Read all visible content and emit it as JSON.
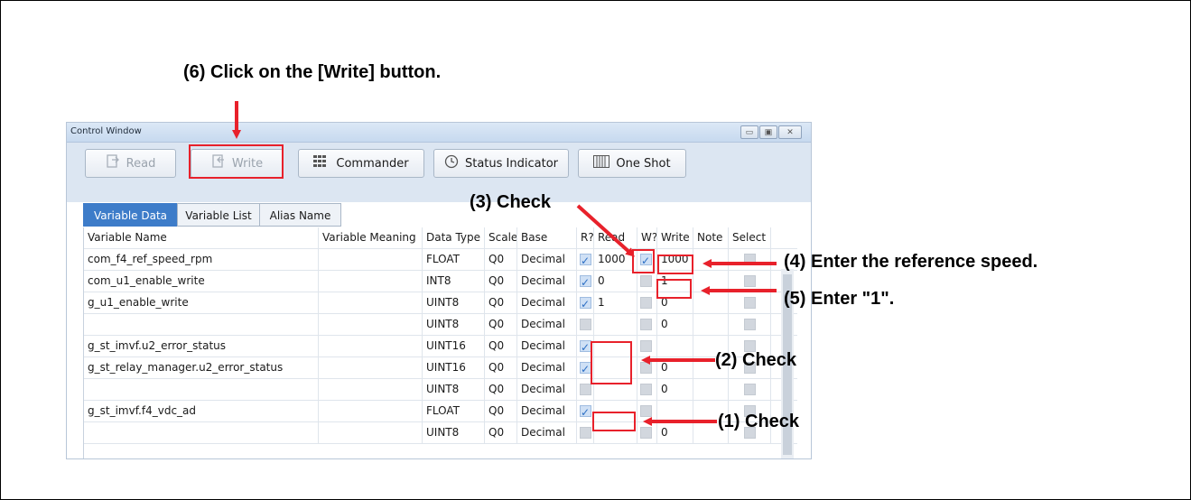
{
  "annotations": {
    "step6": "(6) Click on the [Write] button.",
    "step3": "(3) Check",
    "step4": "(4) Enter the reference speed.",
    "step5": "(5) Enter \"1\".",
    "step2": "(2) Check",
    "step1": "(1) Check",
    "accent_color": "#e8212b"
  },
  "window": {
    "title": "Control Window",
    "controls": [
      "minimize-icon",
      "maximize-icon",
      "close-icon"
    ]
  },
  "toolbar": {
    "read_label": "Read",
    "write_label": "Write",
    "commander_label": "Commander",
    "status_label": "Status Indicator",
    "oneshot_label": "One Shot",
    "read_icon": "read-icon",
    "write_icon": "write-icon",
    "commander_icon": "commander-icon",
    "status_icon": "clock-icon",
    "oneshot_icon": "one-shot-icon"
  },
  "tabs": [
    "Variable Data",
    "Variable List",
    "Alias Name"
  ],
  "table": {
    "headers": [
      "Variable Name",
      "Variable Meaning",
      "Data Type",
      "Scale",
      "Base",
      "R?",
      "Read",
      "W?",
      "Write",
      "Note",
      "Select"
    ],
    "rows": [
      {
        "name": "com_f4_ref_speed_rpm",
        "meaning": "",
        "type": "FLOAT",
        "scale": "Q0",
        "base": "Decimal",
        "r": true,
        "read": "1000",
        "w": true,
        "write": "1000"
      },
      {
        "name": "com_u1_enable_write",
        "meaning": "",
        "type": "INT8",
        "scale": "Q0",
        "base": "Decimal",
        "r": true,
        "read": "0",
        "w": false,
        "write": "1"
      },
      {
        "name": "g_u1_enable_write",
        "meaning": "",
        "type": "UINT8",
        "scale": "Q0",
        "base": "Decimal",
        "r": true,
        "read": "1",
        "w": false,
        "write": "0"
      },
      {
        "name": "",
        "meaning": "",
        "type": "UINT8",
        "scale": "Q0",
        "base": "Decimal",
        "r": false,
        "read": "",
        "w": false,
        "write": "0"
      },
      {
        "name": "g_st_imvf.u2_error_status",
        "meaning": "",
        "type": "UINT16",
        "scale": "Q0",
        "base": "Decimal",
        "r": true,
        "read": "",
        "w": false,
        "write": ""
      },
      {
        "name": "g_st_relay_manager.u2_error_status",
        "meaning": "",
        "type": "UINT16",
        "scale": "Q0",
        "base": "Decimal",
        "r": true,
        "read": "",
        "w": false,
        "write": "0"
      },
      {
        "name": "",
        "meaning": "",
        "type": "UINT8",
        "scale": "Q0",
        "base": "Decimal",
        "r": false,
        "read": "",
        "w": false,
        "write": "0"
      },
      {
        "name": "g_st_imvf.f4_vdc_ad",
        "meaning": "",
        "type": "FLOAT",
        "scale": "Q0",
        "base": "Decimal",
        "r": true,
        "read": "",
        "w": false,
        "write": ""
      },
      {
        "name": "",
        "meaning": "",
        "type": "UINT8",
        "scale": "Q0",
        "base": "Decimal",
        "r": false,
        "read": "",
        "w": false,
        "write": "0"
      }
    ]
  }
}
